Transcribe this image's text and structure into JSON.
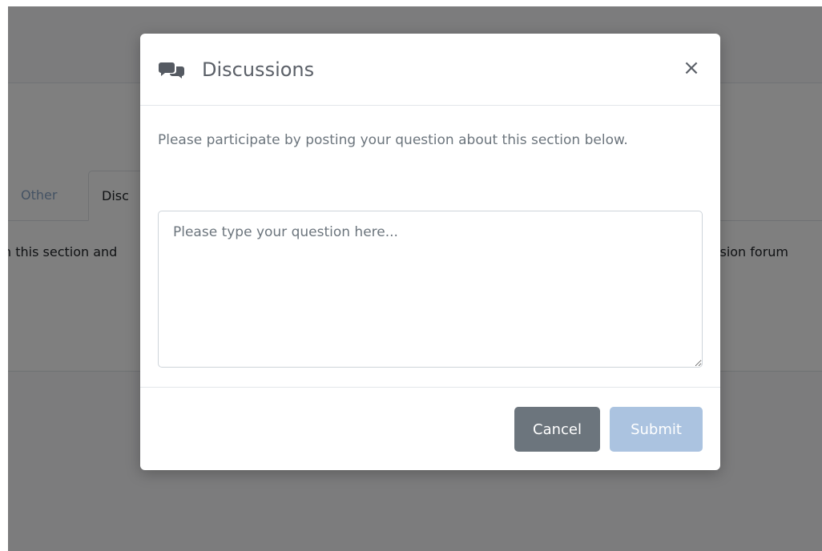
{
  "background": {
    "tabs": [
      {
        "label": "Other"
      },
      {
        "label": "Disc"
      }
    ],
    "text_left": "n this section and",
    "text_right": "ussion forum"
  },
  "modal": {
    "title": "Discussions",
    "title_icon": "comments-icon",
    "close_label": "×",
    "prompt": "Please participate by posting your question about this section below.",
    "question_input": {
      "value": "",
      "placeholder": "Please type your question here..."
    },
    "cancel_label": "Cancel",
    "submit_label": "Submit"
  },
  "colors": {
    "backdrop": "#000000",
    "cancel_button": "#6c757d",
    "submit_button": "#8fb0d6",
    "tab_other": "#8aa7c9"
  }
}
